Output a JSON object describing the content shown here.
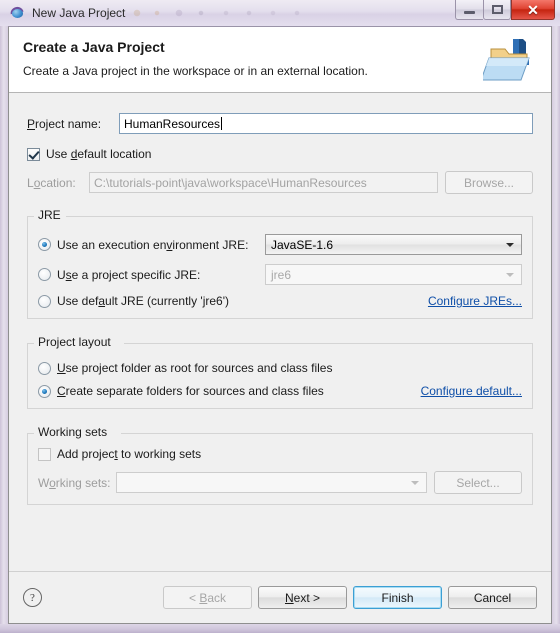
{
  "window": {
    "title": "New Java Project",
    "title_icon": "java-project-icon",
    "controls": {
      "minimize": "minimize-icon",
      "maximize": "maximize-icon",
      "close": "✕"
    }
  },
  "header": {
    "title": "Create a Java Project",
    "subtitle": "Create a Java project in the workspace or in an external location.",
    "icon": "new-java-project-banner-icon"
  },
  "form": {
    "project_name_label": "Project name:",
    "project_name_value": "HumanResources",
    "use_default_location_label": "Use default location",
    "use_default_location_checked": true,
    "location_label": "Location:",
    "location_value": "C:\\tutorials-point\\java\\workspace\\HumanResources",
    "location_enabled": false,
    "browse_label": "Browse...",
    "browse_enabled": false
  },
  "jre": {
    "group_title": "JRE",
    "options": [
      {
        "label": "Use an execution environment JRE:",
        "underline_char": "v",
        "selected": true,
        "combo_value": "JavaSE-1.6",
        "combo_enabled": true
      },
      {
        "label": "Use a project specific JRE:",
        "underline_char": "s",
        "selected": false,
        "combo_value": "jre6",
        "combo_enabled": false
      },
      {
        "label": "Use default JRE (currently 'jre6')",
        "underline_char": "a",
        "selected": false
      }
    ],
    "configure_link": "Configure JREs..."
  },
  "project_layout": {
    "group_title": "Project layout",
    "options": [
      {
        "label": "Use project folder as root for sources and class files",
        "selected": false
      },
      {
        "label": "Create separate folders for sources and class files",
        "selected": true
      }
    ],
    "configure_link": "Configure default..."
  },
  "working_sets": {
    "group_title": "Working sets",
    "add_label": "Add project to working sets",
    "add_checked": false,
    "sets_label": "Working sets:",
    "sets_value": "",
    "sets_enabled": false,
    "select_label": "Select...",
    "select_enabled": false
  },
  "footer": {
    "help_icon": "?",
    "back_label": "< Back",
    "back_enabled": false,
    "next_label": "Next >",
    "next_enabled": true,
    "finish_label": "Finish",
    "finish_default": true,
    "cancel_label": "Cancel"
  },
  "colors": {
    "link": "#0f4fa8",
    "default_button_border": "#3c9fd4",
    "close_button": "#c52410",
    "radio_dot": "#1b76bc",
    "dialog_background": "#f0f0f0"
  }
}
